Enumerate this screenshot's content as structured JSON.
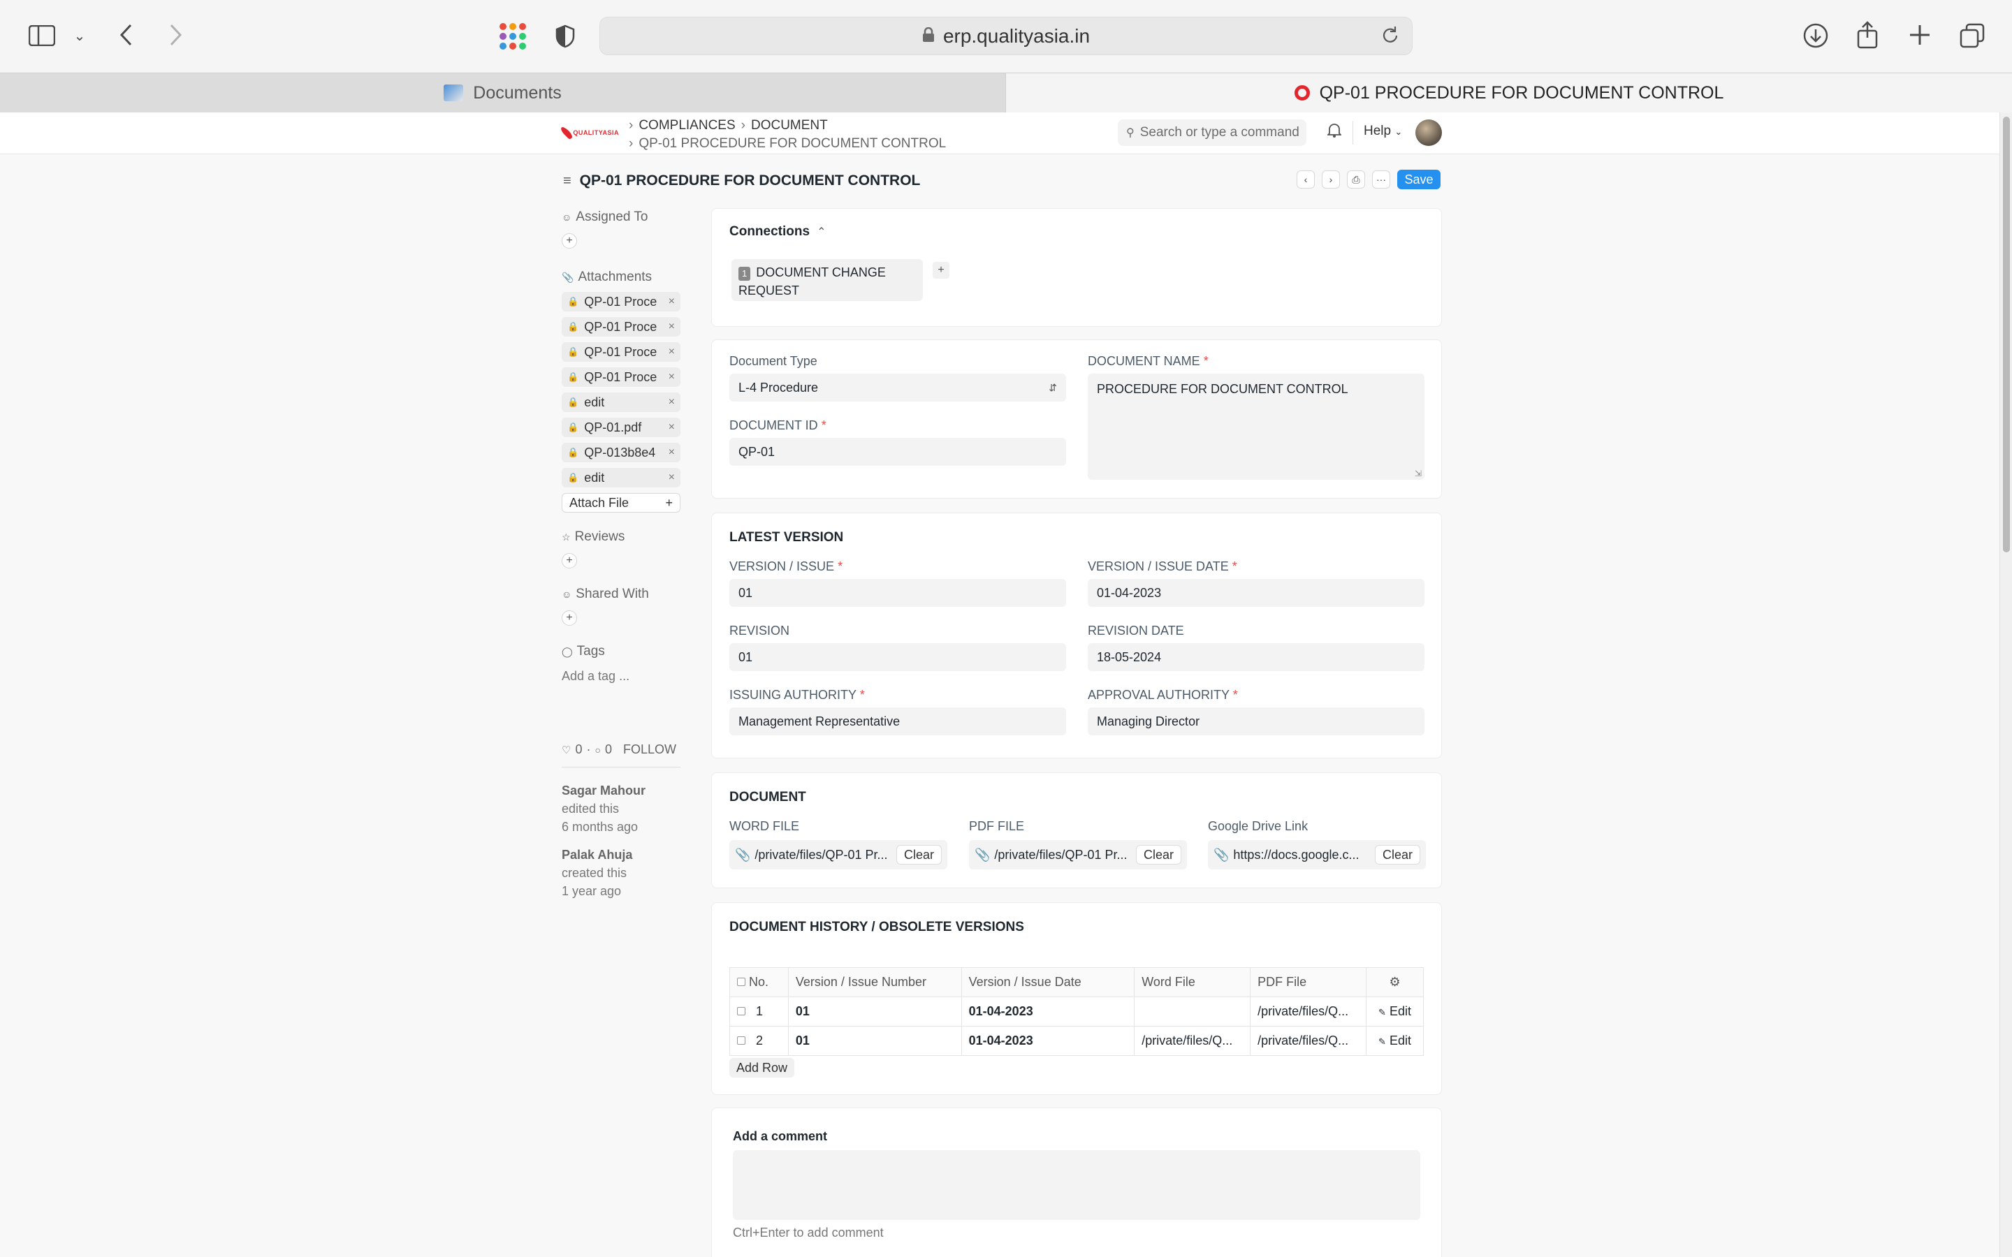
{
  "browser": {
    "url": "erp.qualityasia.in",
    "tabs": [
      {
        "title": "Documents"
      },
      {
        "title": "QP-01 PROCEDURE FOR DOCUMENT CONTROL"
      }
    ]
  },
  "navbar": {
    "logo_text": "QUALITYASIA",
    "breadcrumb": [
      "COMPLIANCES",
      "DOCUMENT",
      "QP-01 PROCEDURE FOR DOCUMENT CONTROL"
    ],
    "search_placeholder": "Search or type a command",
    "help_label": "Help"
  },
  "page": {
    "title": "QP-01 PROCEDURE FOR DOCUMENT CONTROL",
    "save_label": "Save"
  },
  "sidebar": {
    "assigned_to": "Assigned To",
    "attachments_label": "Attachments",
    "attachments": [
      "QP-01 Proce",
      "QP-01 Proce",
      "QP-01 Proce",
      "QP-01 Proce",
      "edit",
      "QP-01.pdf",
      "QP-013b8e4",
      "edit"
    ],
    "attach_file": "Attach File",
    "reviews": "Reviews",
    "shared_with": "Shared With",
    "tags": "Tags",
    "add_tag": "Add a tag ...",
    "likes": "0",
    "comments": "0",
    "follow": "FOLLOW",
    "activity": [
      {
        "user": "Sagar Mahour",
        "action": "edited this",
        "time": "6 months ago"
      },
      {
        "user": "Palak Ahuja",
        "action": "created this",
        "time": "1 year ago"
      }
    ]
  },
  "connections": {
    "title": "Connections",
    "items": [
      {
        "count": "1",
        "label": "DOCUMENT CHANGE REQUEST"
      }
    ]
  },
  "details": {
    "document_type_label": "Document Type",
    "document_type": "L-4 Procedure",
    "document_name_label": "DOCUMENT NAME",
    "document_name": "PROCEDURE FOR DOCUMENT CONTROL",
    "document_id_label": "DOCUMENT ID",
    "document_id": "QP-01"
  },
  "latest_version": {
    "title": "LATEST VERSION",
    "version_label": "VERSION / ISSUE",
    "version": "01",
    "version_date_label": "VERSION / ISSUE DATE",
    "version_date": "01-04-2023",
    "revision_label": "REVISION",
    "revision": "01",
    "revision_date_label": "REVISION DATE",
    "revision_date": "18-05-2024",
    "issuing_label": "ISSUING AUTHORITY",
    "issuing": "Management Representative",
    "approval_label": "APPROVAL AUTHORITY",
    "approval": "Managing Director"
  },
  "document": {
    "title": "DOCUMENT",
    "word_label": "WORD FILE",
    "word_value": "/private/files/QP-01 Pr...",
    "pdf_label": "PDF FILE",
    "pdf_value": "/private/files/QP-01 Pr...",
    "gdrive_label": "Google Drive Link",
    "gdrive_value": "https://docs.google.c...",
    "clear_label": "Clear"
  },
  "history": {
    "title": "DOCUMENT HISTORY / OBSOLETE VERSIONS",
    "columns": [
      "No.",
      "Version / Issue Number",
      "Version / Issue Date",
      "Word File",
      "PDF File"
    ],
    "rows": [
      {
        "no": "1",
        "version": "01",
        "date": "01-04-2023",
        "word": "",
        "pdf": "/private/files/Q..."
      },
      {
        "no": "2",
        "version": "01",
        "date": "01-04-2023",
        "word": "/private/files/Q...",
        "pdf": "/private/files/Q..."
      }
    ],
    "edit_label": "Edit",
    "add_row": "Add Row"
  },
  "comment": {
    "title": "Add a comment",
    "hint": "Ctrl+Enter to add comment"
  },
  "colors": {
    "primary": "#2490ef",
    "required": "#e24c4c",
    "brand": "#e3262d"
  }
}
